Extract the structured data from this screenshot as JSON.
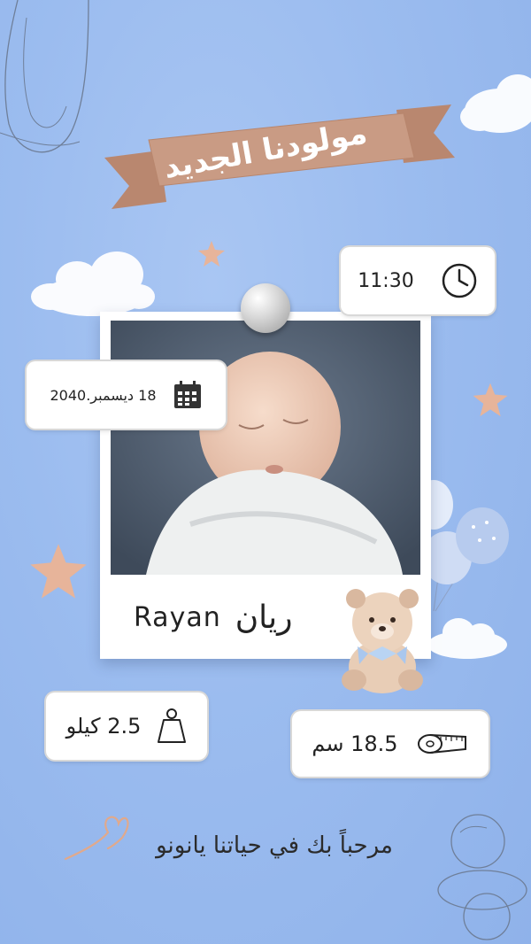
{
  "banner": {
    "title": "مولودنا الجديد"
  },
  "time": {
    "value": "11:30",
    "icon": "clock-icon"
  },
  "date": {
    "value": "18 ديسمبر.2040",
    "icon": "calendar-icon"
  },
  "baby": {
    "name_en": "Rayan",
    "name_ar": "ريان"
  },
  "weight": {
    "value": "2.5 كيلو",
    "icon": "weight-icon"
  },
  "length": {
    "value": "18.5 سم",
    "icon": "tape-measure-icon"
  },
  "welcome": {
    "text": "مرحباً بك في حياتنا يانونو"
  },
  "colors": {
    "background": "#9bbcef",
    "ribbon": "#c99b84",
    "star": "#e7b49a",
    "text": "#222222"
  }
}
